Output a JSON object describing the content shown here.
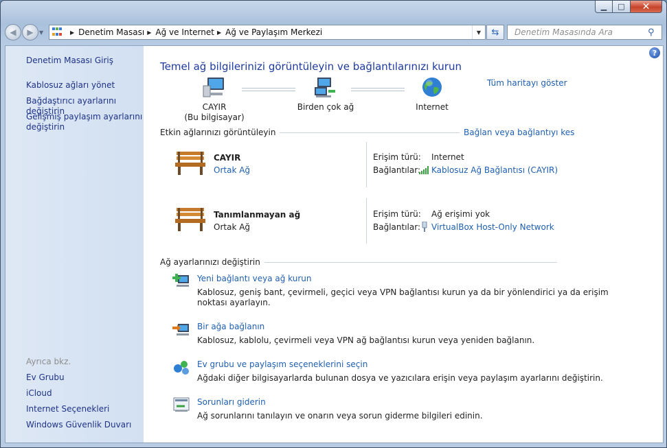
{
  "window": {
    "caption": {
      "minimize": "▁",
      "maximize": "□",
      "close": "✕"
    }
  },
  "nav": {
    "back_icon": "◀",
    "forward_icon": "▶",
    "breadcrumbs": [
      "Denetim Masası",
      "Ağ ve Internet",
      "Ağ ve Paylaşım Merkezi"
    ],
    "search_placeholder": "Denetim Masasında Ara"
  },
  "sidebar": {
    "home": "Denetim Masası Giriş",
    "tasks": [
      "Kablosuz ağları yönet",
      "Bağdaştırıcı ayarlarını değiştirin",
      "Gelişmiş paylaşım ayarlarını",
      "değiştirin"
    ],
    "see_also_heading": "Ayrıca bkz.",
    "see_also": [
      "Ev Grubu",
      "iCloud",
      "Internet Seçenekleri",
      "Windows Güvenlik Duvarı"
    ]
  },
  "main": {
    "title": "Temel ağ bilgilerinizi görüntüleyin ve bağlantılarınızı kurun",
    "full_map_link": "Tüm haritayı göster",
    "map": {
      "computer_name": "CAYIR",
      "computer_sub": "(Bu bilgisayar)",
      "network": "Birden çok ağ",
      "internet": "Internet"
    },
    "active_section": "Etkin ağlarınızı görüntüleyin",
    "connect_link": "Bağlan veya bağlantıyı kes",
    "networks": [
      {
        "name": "CAYIR",
        "type": "Ortak Ağ",
        "type_is_link": true,
        "access_label": "Erişim türü:",
        "access_value": "Internet",
        "conn_label": "Bağlantılar:",
        "conn_value": "Kablosuz Ağ Bağlantısı (CAYIR)",
        "conn_icon": "wifi-signal-icon"
      },
      {
        "name": "Tanımlanmayan ağ",
        "type": "Ortak Ağ",
        "type_is_link": false,
        "access_label": "Erişim türü:",
        "access_value": "Ağ erişimi yok",
        "conn_label": "Bağlantılar:",
        "conn_value": "VirtualBox Host-Only Network",
        "conn_icon": "ethernet-plug-icon"
      }
    ],
    "settings_section": "Ağ ayarlarınızı değiştirin",
    "tasks": [
      {
        "title": "Yeni bağlantı veya ağ kurun",
        "desc1": "Kablosuz, geniş bant, çevirmeli, geçici veya VPN bağlantısı kurun ya da bir yönlendirici ya da erişim",
        "desc2": "noktası ayarlayın."
      },
      {
        "title": "Bir ağa bağlanın",
        "desc1": "Kablosuz, kablolu, çevirmeli veya VPN ağ bağlantısı kurun veya yeniden bağlanın.",
        "desc2": ""
      },
      {
        "title": "Ev grubu ve paylaşım seçeneklerini seçin",
        "desc1": "Ağdaki diğer bilgisayarlarda bulunan dosya ve yazıcılara erişin veya paylaşım ayarlarını değiştirin.",
        "desc2": ""
      },
      {
        "title": "Sorunları giderin",
        "desc1": "Ağ sorunlarını tanılayın ve onarın veya sorun giderme bilgileri edinin.",
        "desc2": ""
      }
    ]
  },
  "colors": {
    "link": "#1f5fb0",
    "title": "#1e3a9e",
    "sidebar_link": "#1e3287"
  }
}
